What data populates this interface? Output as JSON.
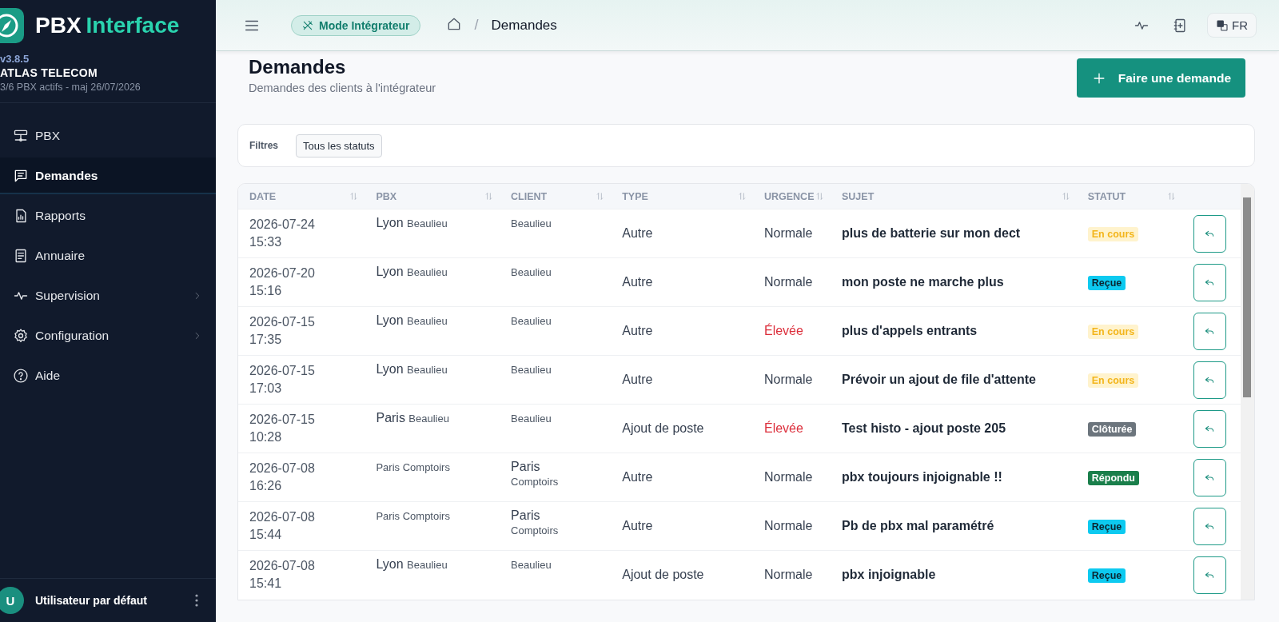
{
  "sidebar": {
    "brand": {
      "first": "PBX",
      "second": "Interface"
    },
    "version": "v3.8.5",
    "company": "ATLAS TELECOM",
    "summary": "3/6 PBX actifs - maj 26/07/2026",
    "items": [
      {
        "label": "PBX",
        "kind": "server",
        "selected": false
      },
      {
        "label": "Demandes",
        "kind": "chat",
        "selected": true
      },
      {
        "label": "Rapports",
        "kind": "report",
        "selected": false
      },
      {
        "label": "Annuaire",
        "kind": "book",
        "selected": false
      },
      {
        "label": "Supervision",
        "kind": "pulse",
        "selected": false,
        "expanded": false
      },
      {
        "label": "Configuration",
        "kind": "gear",
        "selected": false,
        "expanded": false
      },
      {
        "label": "Aide",
        "kind": "help",
        "selected": false
      }
    ],
    "user": {
      "initial": "U",
      "name": "Utilisateur par défaut"
    }
  },
  "header": {
    "mode": "Mode Intégrateur",
    "separator": "/",
    "breadcrumb": "Demandes",
    "language": "FR"
  },
  "page": {
    "title": "Demandes",
    "subtitle": "Demandes des clients à l'intégrateur",
    "action": "Faire une demande"
  },
  "filters": {
    "label": "Filtres",
    "status": "Tous les statuts"
  },
  "table": {
    "columns": [
      "DATE",
      "PBX",
      "CLIENT",
      "TYPE",
      "URGENCE",
      "SUJET",
      "STATUT"
    ],
    "rows": [
      {
        "date": "2026-07-24 15:33",
        "pbx": {
          "name": "Lyon",
          "site": "Beaulieu"
        },
        "client": {
          "site": "Beaulieu"
        },
        "type": "Autre",
        "urgency": {
          "label": "Normale",
          "kind": "normal"
        },
        "subject": "plus de batterie sur mon dect",
        "status": {
          "label": "En cours",
          "kind": "progress"
        }
      },
      {
        "date": "2026-07-20 15:16",
        "pbx": {
          "name": "Lyon",
          "site": "Beaulieu"
        },
        "client": {
          "site": "Beaulieu"
        },
        "type": "Autre",
        "urgency": {
          "label": "Normale",
          "kind": "normal"
        },
        "subject": "mon poste ne marche plus",
        "status": {
          "label": "Reçue",
          "kind": "received"
        }
      },
      {
        "date": "2026-07-15 17:35",
        "pbx": {
          "name": "Lyon",
          "site": "Beaulieu"
        },
        "client": {
          "site": "Beaulieu"
        },
        "type": "Autre",
        "urgency": {
          "label": "Élevée",
          "kind": "high"
        },
        "subject": "plus d'appels entrants",
        "status": {
          "label": "En cours",
          "kind": "progress"
        }
      },
      {
        "date": "2026-07-15 17:03",
        "pbx": {
          "name": "Lyon",
          "site": "Beaulieu"
        },
        "client": {
          "site": "Beaulieu"
        },
        "type": "Autre",
        "urgency": {
          "label": "Normale",
          "kind": "normal"
        },
        "subject": "Prévoir un ajout de file d'attente",
        "status": {
          "label": "En cours",
          "kind": "progress"
        }
      },
      {
        "date": "2026-07-15 10:28",
        "pbx": {
          "name": "Paris",
          "site": "Beaulieu"
        },
        "client": {
          "site": "Beaulieu"
        },
        "type": "Ajout de poste",
        "urgency": {
          "label": "Élevée",
          "kind": "high"
        },
        "subject": "Test histo - ajout poste 205",
        "status": {
          "label": "Clôturée",
          "kind": "closed"
        }
      },
      {
        "date": "2026-07-08 16:26",
        "pbx": {
          "site": "Paris Comptoirs"
        },
        "client": {
          "name": "Paris",
          "site": "Comptoirs"
        },
        "type": "Autre",
        "urgency": {
          "label": "Normale",
          "kind": "normal"
        },
        "subject": "pbx toujours injoignable !!",
        "status": {
          "label": "Répondu",
          "kind": "answered"
        }
      },
      {
        "date": "2026-07-08 15:44",
        "pbx": {
          "site": "Paris Comptoirs"
        },
        "client": {
          "name": "Paris",
          "site": "Comptoirs"
        },
        "type": "Autre",
        "urgency": {
          "label": "Normale",
          "kind": "normal"
        },
        "subject": "Pb de pbx mal paramétré",
        "status": {
          "label": "Reçue",
          "kind": "received"
        }
      },
      {
        "date": "2026-07-08 15:41",
        "pbx": {
          "name": "Lyon",
          "site": "Beaulieu"
        },
        "client": {
          "site": "Beaulieu"
        },
        "type": "Ajout de poste",
        "urgency": {
          "label": "Normale",
          "kind": "normal"
        },
        "subject": "pbx injoignable",
        "status": {
          "label": "Reçue",
          "kind": "received"
        }
      }
    ]
  }
}
